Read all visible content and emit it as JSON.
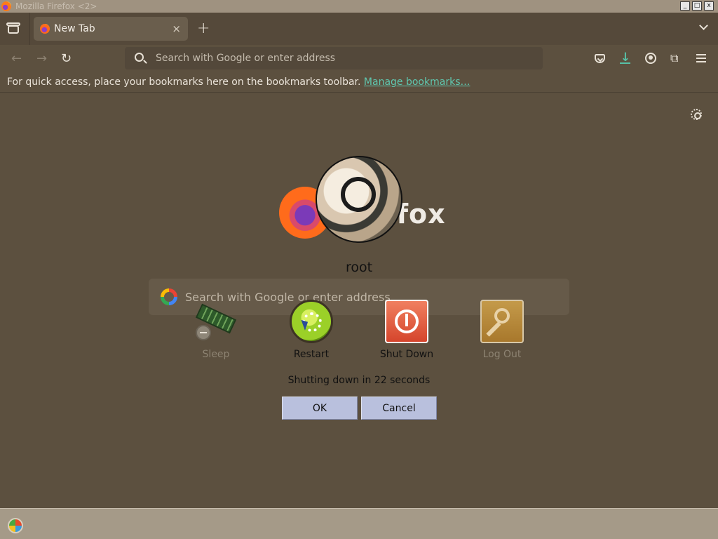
{
  "window": {
    "title": "Mozilla Firefox <2>",
    "min_label": "_",
    "max_label": "□",
    "close_label": "x"
  },
  "tabs": [
    {
      "label": "New Tab",
      "close": "×"
    }
  ],
  "new_tab_label": "+",
  "nav": {
    "back": "←",
    "forward": "→",
    "reload": "↻"
  },
  "urlbar": {
    "placeholder": "Search with Google or enter address",
    "value": ""
  },
  "toolbar": {
    "extensions_glyph": "⧉"
  },
  "bookmarks_bar": {
    "message": "For quick access, place your bookmarks here on the bookmarks toolbar.",
    "link": "Manage bookmarks…"
  },
  "newtab_page": {
    "brand_word": "Firefox",
    "search_placeholder": "Search with Google or enter address"
  },
  "logout_dialog": {
    "user": "root",
    "actions": [
      {
        "label": "Sleep",
        "enabled": false
      },
      {
        "label": "Restart",
        "enabled": true
      },
      {
        "label": "Shut Down",
        "enabled": true
      },
      {
        "label": "Log Out",
        "enabled": false
      }
    ],
    "countdown": "Shutting down in 22 seconds",
    "ok_label": "OK",
    "cancel_label": "Cancel"
  },
  "colors": {
    "theme_bg": "#5c503f",
    "link": "#5fc8b0",
    "download_accent": "#57c0a6",
    "dialog_button": "#b9c0dd"
  }
}
